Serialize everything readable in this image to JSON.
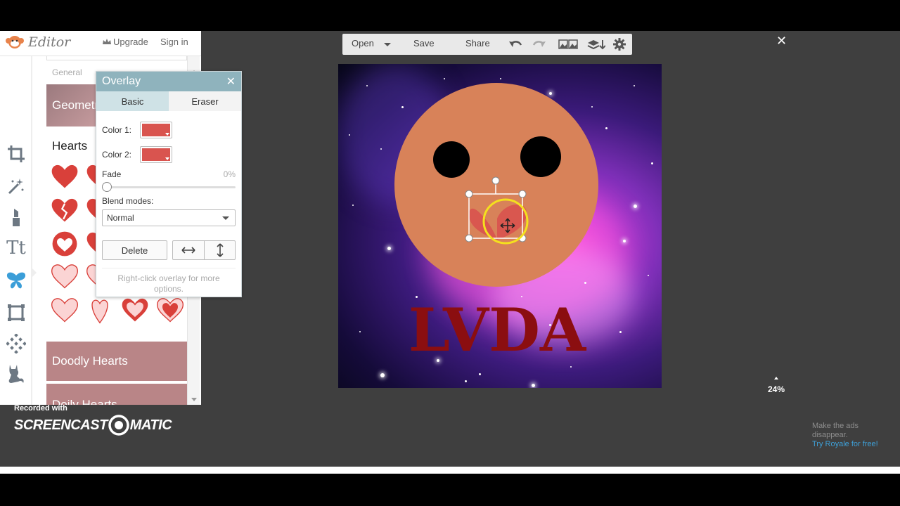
{
  "app": {
    "title": "Editor",
    "upgrade_label": "Upgrade",
    "signin_label": "Sign in"
  },
  "library": {
    "general_label": "General",
    "geometric_label": "Geometric",
    "hearts_title": "Hearts",
    "doodly_label": "Doodly Hearts",
    "doily_label": "Doily Hearts"
  },
  "toolbar": {
    "open_label": "Open",
    "save_label": "Save",
    "share_label": "Share"
  },
  "overlay_dialog": {
    "title": "Overlay",
    "tab_basic": "Basic",
    "tab_eraser": "Eraser",
    "color1_label": "Color 1:",
    "color2_label": "Color 2:",
    "color1": "#d9544f",
    "color2": "#d9544f",
    "fade_label": "Fade",
    "fade_value": "0%",
    "fade_level": 0,
    "blend_label": "Blend modes:",
    "blend_value": "Normal",
    "delete_label": "Delete",
    "hint": "Right-click overlay for more options."
  },
  "canvas": {
    "text": "LVDA",
    "face_color": "#d88259",
    "text_color": "#8b0e10"
  },
  "zoom": {
    "value": "24%"
  },
  "ads": {
    "line1": "Make the ads disappear.",
    "link": "Try Royale for free!"
  },
  "recorder": {
    "recorded_with": "Recorded with",
    "brand_left": "SCREENCAST",
    "brand_right": "MATIC"
  },
  "icons": [
    "crop-icon",
    "magic-wand-icon",
    "lipstick-icon",
    "text-icon",
    "butterfly-icon",
    "frame-icon",
    "texture-icon",
    "cat-icon",
    "undo-icon",
    "redo-icon",
    "image-collage-icon",
    "layers-icon",
    "gear-icon",
    "close-icon",
    "crown-icon"
  ]
}
